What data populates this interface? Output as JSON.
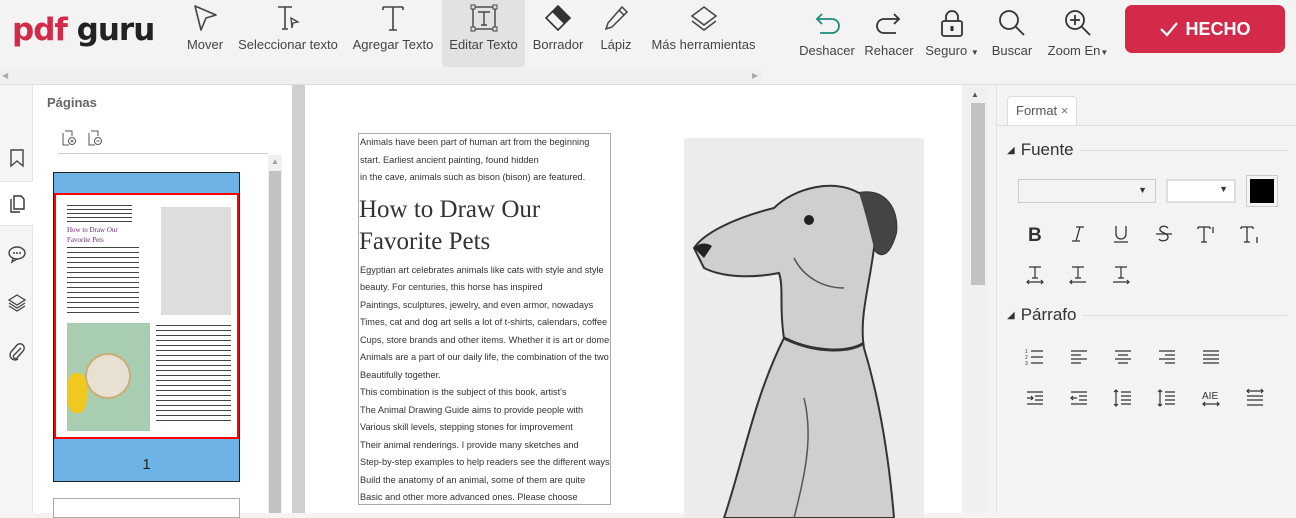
{
  "app": {
    "logo_pdf": "pdf",
    "logo_guru": "guru"
  },
  "toolbar": {
    "tools": [
      {
        "label": "Mover",
        "icon": "cursor-arrow-icon"
      },
      {
        "label": "Seleccionar texto",
        "icon": "select-text-icon"
      },
      {
        "label": "Agregar Texto",
        "icon": "add-text-icon"
      },
      {
        "label": "Editar Texto",
        "icon": "edit-text-icon",
        "active": true
      },
      {
        "label": "Borrador",
        "icon": "eraser-icon"
      },
      {
        "label": "Lápiz",
        "icon": "pencil-icon"
      },
      {
        "label": "Más herramientas",
        "icon": "layers-icon"
      }
    ],
    "undo": "Deshacer",
    "redo": "Rehacer",
    "secure": "Seguro",
    "search": "Buscar",
    "zoom": "Zoom En",
    "done": "HECHO"
  },
  "colors": {
    "brand": "#d42a4a",
    "undo": "#1e8a7a",
    "thumb_bg": "#6db3e6",
    "thumb_sel": "#ff0000"
  },
  "pages_panel": {
    "title": "Páginas",
    "page_number": "1"
  },
  "document": {
    "intro": [
      "Animals have been part of human art from the beginning",
      "start. Earliest ancient painting, found hidden",
      "in the cave, animals such as bison (bison) are featured."
    ],
    "title_line1": "How to Draw Our",
    "title_line2": "Favorite Pets",
    "body": [
      "Egyptian art celebrates animals like cats with style and style",
      "beauty. For centuries, this horse has inspired",
      "Paintings, sculptures, jewelry, and even armor, nowadays",
      "Times, cat and dog art sells a lot of t-shirts, calendars, coffee",
      "Cups, store brands and other items. Whether it is art or domestic",
      "Animals are a part of our daily life, the combination of the two",
      "Beautifully together.",
      "This combination is the subject of this book, artist's",
      "The Animal Drawing Guide aims to provide people with",
      "Various skill levels, stepping stones for improvement",
      "Their animal renderings. I provide many sketches and",
      "Step-by-step examples to help readers see the different ways",
      "Build the anatomy of an animal, some of them are quite",
      "Basic and other more advanced ones. Please choose"
    ]
  },
  "format_panel": {
    "tab": "Format",
    "close": "×",
    "font_section": "Fuente",
    "paragraph_section": "Párrafo",
    "font_color": "#000000"
  }
}
